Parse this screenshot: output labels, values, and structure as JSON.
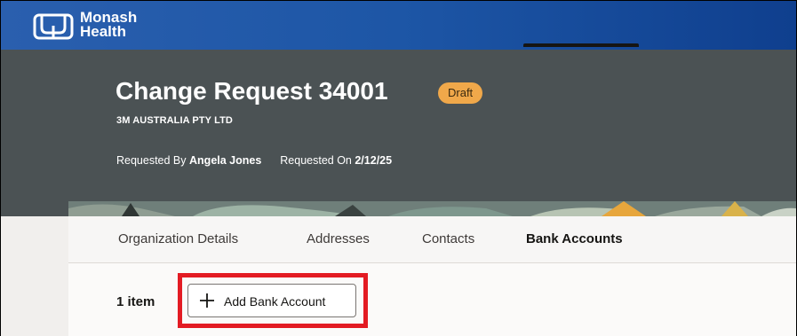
{
  "brand": {
    "line1": "Monash",
    "line2": "Health"
  },
  "header": {
    "title": "Change Request 34001",
    "status": "Draft",
    "company": "3M AUSTRALIA PTY LTD",
    "requested_by_label": "Requested By",
    "requested_by": "Angela Jones",
    "requested_on_label": "Requested On",
    "requested_on": "2/12/25"
  },
  "tabs": [
    {
      "label": "Organization Details"
    },
    {
      "label": "Addresses"
    },
    {
      "label": "Contacts"
    },
    {
      "label": "Bank Accounts",
      "active": true
    }
  ],
  "toolbar": {
    "item_count": "1 item",
    "add_label": "Add Bank Account"
  },
  "colors": {
    "topbar": "#1d56a6",
    "banner": "#4b5254",
    "badge": "#f0a84a",
    "highlight": "#e31b23"
  },
  "icons": {
    "logo": "monash-logo-icon",
    "add": "plus-icon"
  }
}
